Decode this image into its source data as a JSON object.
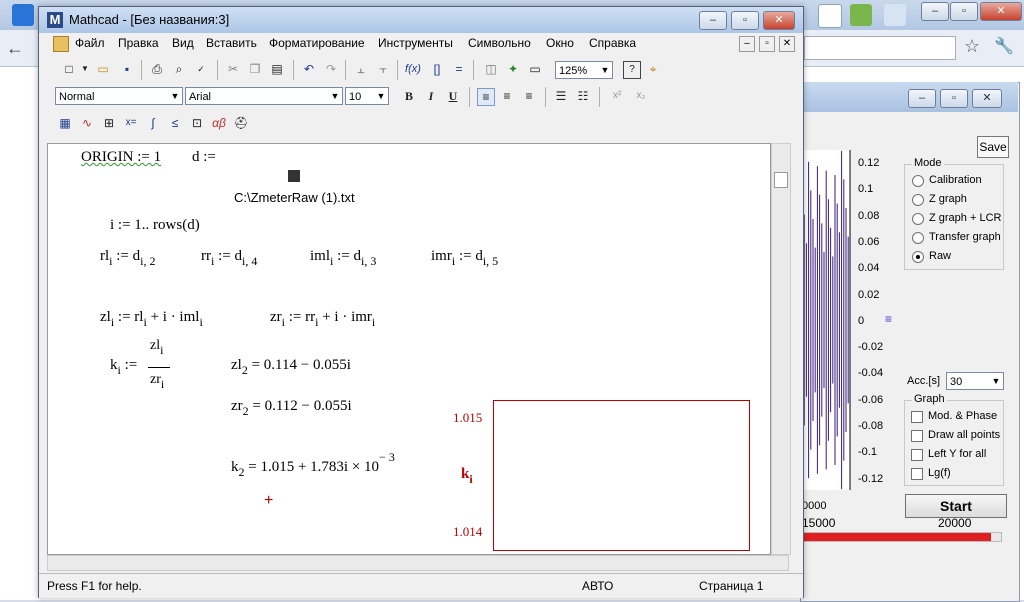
{
  "mathcad": {
    "title": "Mathcad - [Без названия:3]",
    "menu": [
      "Файл",
      "Правка",
      "Вид",
      "Вставить",
      "Форматирование",
      "Инструменты",
      "Символьно",
      "Окно",
      "Справка"
    ],
    "zoom": "125%",
    "style_value": "Normal",
    "font_value": "Arial",
    "size_value": "10",
    "bold": "B",
    "italic": "I",
    "underline": "U",
    "worksheet": {
      "origin": "ORIGIN := 1",
      "d_assign": "d :=",
      "file_name": "C:\\ZmeterRaw (1).txt",
      "range": "i := 1.. rows(d)",
      "rl": [
        "rl",
        "i",
        ":= d",
        "i, 2"
      ],
      "rr": [
        "rr",
        "i",
        ":= d",
        "i, 4"
      ],
      "iml": [
        "iml",
        "i",
        ":= d",
        "i, 3"
      ],
      "imr": [
        "imr",
        "i",
        ":= d",
        "i, 5"
      ],
      "zl_def": "zl",
      "zr_def": "zr",
      "k_def": "k",
      "zl2": "= 0.114 − 0.055i",
      "zr2": "= 0.112 − 0.055i",
      "k2": "= 1.015 + 1.783i × 10",
      "k2_exp": "− 3",
      "plot_ymax": "1.015",
      "plot_ymin": "1.014",
      "plot_ylabel": "k",
      "plot_ylabel_sub": "i"
    },
    "status": {
      "help": "Press F1 for help.",
      "mode": "АВТО",
      "page": "Страница 1"
    }
  },
  "right_app": {
    "save_label": "Save",
    "mode_title": "Mode",
    "modes": [
      "Calibration",
      "Z graph",
      "Z graph + LCR",
      "Transfer graph",
      "Raw"
    ],
    "selected_mode": "Raw",
    "y_ticks": [
      "0.12",
      "0.1",
      "0.08",
      "0.06",
      "0.04",
      "0.02",
      "0",
      "-0.02",
      "-0.04",
      "-0.06",
      "-0.08",
      "-0.1",
      "-0.12"
    ],
    "x_ticks": [
      "0000",
      "15000",
      "20000"
    ],
    "acc_label": "Acc.[s]",
    "acc_value": "30",
    "graph_title": "Graph",
    "graph_options": [
      "Mod. & Phase",
      "Draw all points",
      "Left Y for all",
      "Lg(f)"
    ],
    "start_label": "Start",
    "plot_color": "#3a1a7a"
  },
  "colors": {
    "mathcad_red": "#c00000"
  }
}
